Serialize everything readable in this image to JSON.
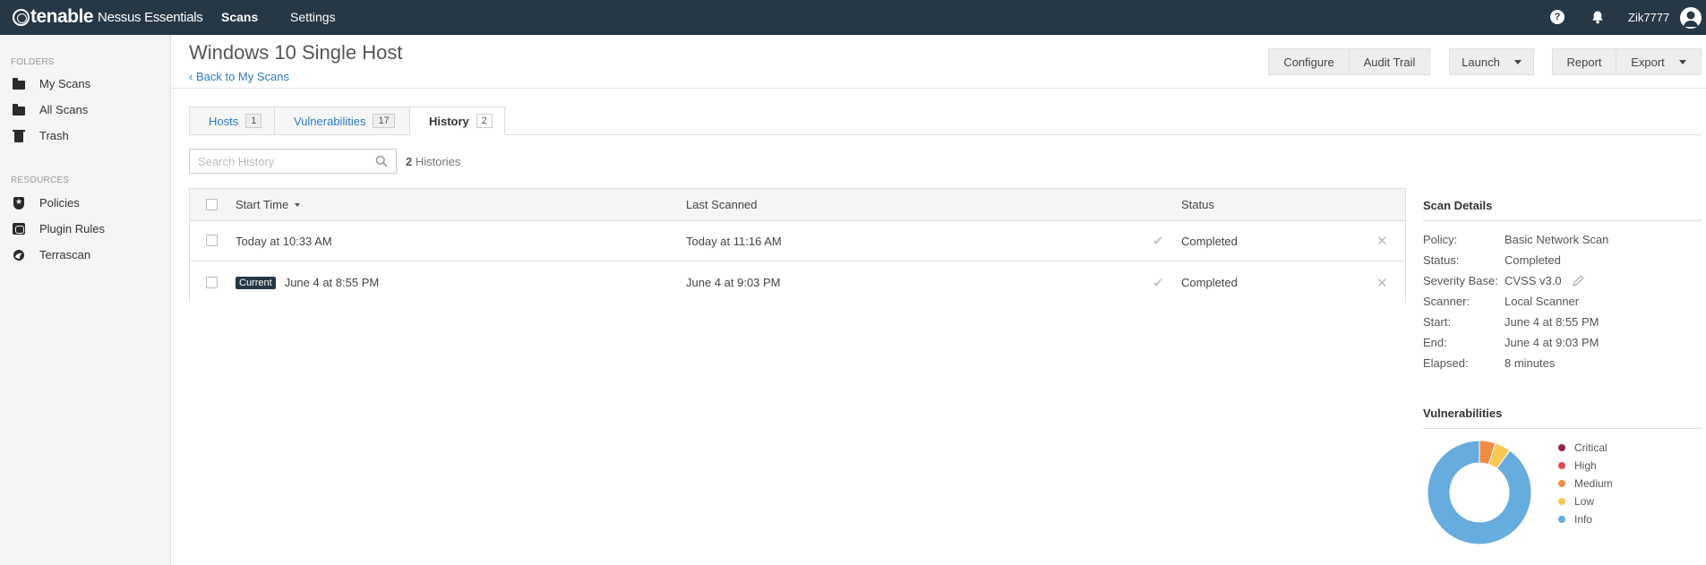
{
  "topbar": {
    "brand": "tenable",
    "product": "Nessus Essentials",
    "nav": {
      "scans": "Scans",
      "settings": "Settings"
    },
    "help_glyph": "?",
    "username": "Zik7777"
  },
  "sidebar": {
    "folders_header": "FOLDERS",
    "folders": [
      {
        "label": "My Scans",
        "icon": "folder-icon"
      },
      {
        "label": "All Scans",
        "icon": "folder-icon"
      },
      {
        "label": "Trash",
        "icon": "trash-icon"
      }
    ],
    "resources_header": "RESOURCES",
    "resources": [
      {
        "label": "Policies",
        "icon": "shield-icon"
      },
      {
        "label": "Plugin Rules",
        "icon": "plugin-icon"
      },
      {
        "label": "Terrascan",
        "icon": "terrascan-icon"
      }
    ]
  },
  "page": {
    "title": "Windows 10 Single Host",
    "back_link": "‹ Back to My Scans"
  },
  "toolbar": {
    "configure": "Configure",
    "audit_trail": "Audit Trail",
    "launch": "Launch",
    "report": "Report",
    "export": "Export"
  },
  "tabs": [
    {
      "label": "Hosts",
      "count": "1"
    },
    {
      "label": "Vulnerabilities",
      "count": "17"
    },
    {
      "label": "History",
      "count": "2",
      "active": true
    }
  ],
  "search": {
    "placeholder": "Search History",
    "count": "2",
    "count_suffix": "Histories"
  },
  "table": {
    "headers": {
      "start_time": "Start Time",
      "last_scanned": "Last Scanned",
      "status": "Status"
    },
    "rows": [
      {
        "current": "",
        "start_time": "Today at 10:33 AM",
        "last_scanned": "Today at 11:16 AM",
        "status": "Completed"
      },
      {
        "current": "Current",
        "start_time": "June 4 at 8:55 PM",
        "last_scanned": "June 4 at 9:03 PM",
        "status": "Completed"
      }
    ]
  },
  "scan_details": {
    "title": "Scan Details",
    "items": [
      {
        "label": "Policy:",
        "value": "Basic Network Scan"
      },
      {
        "label": "Status:",
        "value": "Completed"
      },
      {
        "label": "Severity Base:",
        "value": "CVSS v3.0"
      },
      {
        "label": "Scanner:",
        "value": "Local Scanner"
      },
      {
        "label": "Start:",
        "value": "June 4 at 8:55 PM"
      },
      {
        "label": "End:",
        "value": "June 4 at 9:03 PM"
      },
      {
        "label": "Elapsed:",
        "value": "8 minutes"
      }
    ]
  },
  "vulnerabilities": {
    "title": "Vulnerabilities",
    "legend": [
      {
        "label": "Critical",
        "color": "#91243e"
      },
      {
        "label": "High",
        "color": "#dd4b50"
      },
      {
        "label": "Medium",
        "color": "#f18c43"
      },
      {
        "label": "Low",
        "color": "#f8c851"
      },
      {
        "label": "Info",
        "color": "#67acdf"
      }
    ],
    "chart_slices": [
      {
        "label": "Medium",
        "fraction": 0.05,
        "color": "#f18c43"
      },
      {
        "label": "Low",
        "fraction": 0.05,
        "color": "#f8c851"
      },
      {
        "label": "Info",
        "fraction": 0.9,
        "color": "#67acdf"
      }
    ]
  }
}
